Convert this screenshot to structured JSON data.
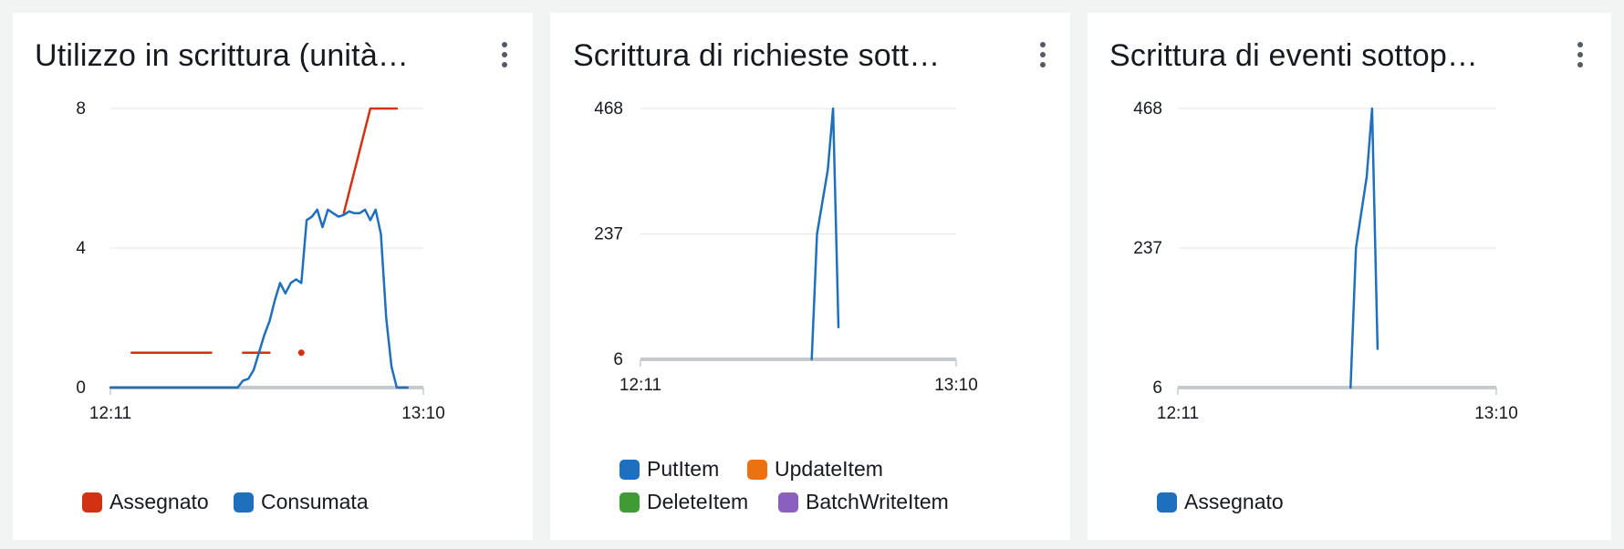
{
  "widgets": [
    {
      "title": "Utilizzo in scrittura (unità…",
      "legend": [
        {
          "label": "Assegnato",
          "color": "#d13212"
        },
        {
          "label": "Consumata",
          "color": "#1f6fbf"
        }
      ]
    },
    {
      "title": "Scrittura di richieste sott…",
      "legend": [
        {
          "label": "PutItem",
          "color": "#1f6fbf"
        },
        {
          "label": "UpdateItem",
          "color": "#ec7211"
        },
        {
          "label": "DeleteItem",
          "color": "#3f9c35"
        },
        {
          "label": "BatchWriteItem",
          "color": "#8b5fbf"
        }
      ]
    },
    {
      "title": "Scrittura di eventi sottop…",
      "legend": [
        {
          "label": "Assegnato",
          "color": "#1f6fbf"
        }
      ]
    }
  ],
  "chart_data": [
    {
      "type": "line",
      "title": "Utilizzo in scrittura (unità…",
      "x_start": "12:11",
      "x_end": "13:10",
      "x_range": [
        0,
        59
      ],
      "ylim": [
        0,
        8
      ],
      "yticks": [
        0,
        4,
        8
      ],
      "xticks": [
        "12:11",
        "13:10"
      ],
      "grid": true,
      "legend_position": "bottom",
      "series": [
        {
          "name": "Assegnato",
          "color": "#d13212",
          "segments": [
            [
              [
                4,
                1
              ],
              [
                19,
                1
              ]
            ],
            [
              [
                25,
                1
              ],
              [
                30,
                1
              ]
            ],
            [
              [
                36,
                1
              ]
            ],
            [
              [
                44,
                5
              ],
              [
                49,
                8
              ],
              [
                54,
                8
              ]
            ]
          ]
        },
        {
          "name": "Consumata",
          "color": "#1f6fbf",
          "segments": [
            [
              [
                0,
                0
              ],
              [
                24,
                0
              ],
              [
                25,
                0.2
              ],
              [
                26,
                0.25
              ],
              [
                27,
                0.5
              ],
              [
                28,
                1
              ],
              [
                29,
                1.5
              ],
              [
                30,
                1.9
              ],
              [
                31,
                2.5
              ],
              [
                32,
                3.0
              ],
              [
                33,
                2.7
              ],
              [
                34,
                3.0
              ],
              [
                35,
                3.1
              ],
              [
                36,
                3.0
              ],
              [
                37,
                4.8
              ],
              [
                38,
                4.9
              ],
              [
                39,
                5.1
              ],
              [
                40,
                4.6
              ],
              [
                41,
                5.1
              ],
              [
                42,
                5.0
              ],
              [
                43,
                4.9
              ],
              [
                44,
                4.95
              ],
              [
                45,
                5.05
              ],
              [
                46,
                5.0
              ],
              [
                47,
                5.0
              ],
              [
                48,
                5.1
              ],
              [
                49,
                4.8
              ],
              [
                50,
                5.1
              ],
              [
                51,
                4.4
              ],
              [
                52,
                2.0
              ],
              [
                53,
                0.6
              ],
              [
                54,
                0
              ],
              [
                56,
                0
              ]
            ]
          ]
        }
      ]
    },
    {
      "type": "line",
      "title": "Scrittura di richieste sott…",
      "x_start": "12:11",
      "x_end": "13:10",
      "x_range": [
        0,
        59
      ],
      "ylim": [
        6,
        468
      ],
      "yticks": [
        6,
        237,
        468
      ],
      "xticks": [
        "12:11",
        "13:10"
      ],
      "grid": true,
      "legend_position": "bottom",
      "series": [
        {
          "name": "PutItem",
          "color": "#1f6fbf",
          "segments": [
            [
              [
                32,
                6
              ],
              [
                33,
                237
              ],
              [
                35,
                355
              ],
              [
                36,
                468
              ],
              [
                37,
                65
              ]
            ]
          ]
        }
      ]
    },
    {
      "type": "line",
      "title": "Scrittura di eventi sottop…",
      "x_start": "12:11",
      "x_end": "13:10",
      "x_range": [
        0,
        59
      ],
      "ylim": [
        6,
        468
      ],
      "yticks": [
        6,
        237,
        468
      ],
      "xticks": [
        "12:11",
        "13:10"
      ],
      "grid": true,
      "legend_position": "bottom",
      "series": [
        {
          "name": "Assegnato",
          "color": "#1f6fbf",
          "segments": [
            [
              [
                32,
                6
              ],
              [
                33,
                237
              ],
              [
                35,
                355
              ],
              [
                36,
                468
              ],
              [
                37,
                70
              ]
            ]
          ]
        }
      ]
    }
  ]
}
